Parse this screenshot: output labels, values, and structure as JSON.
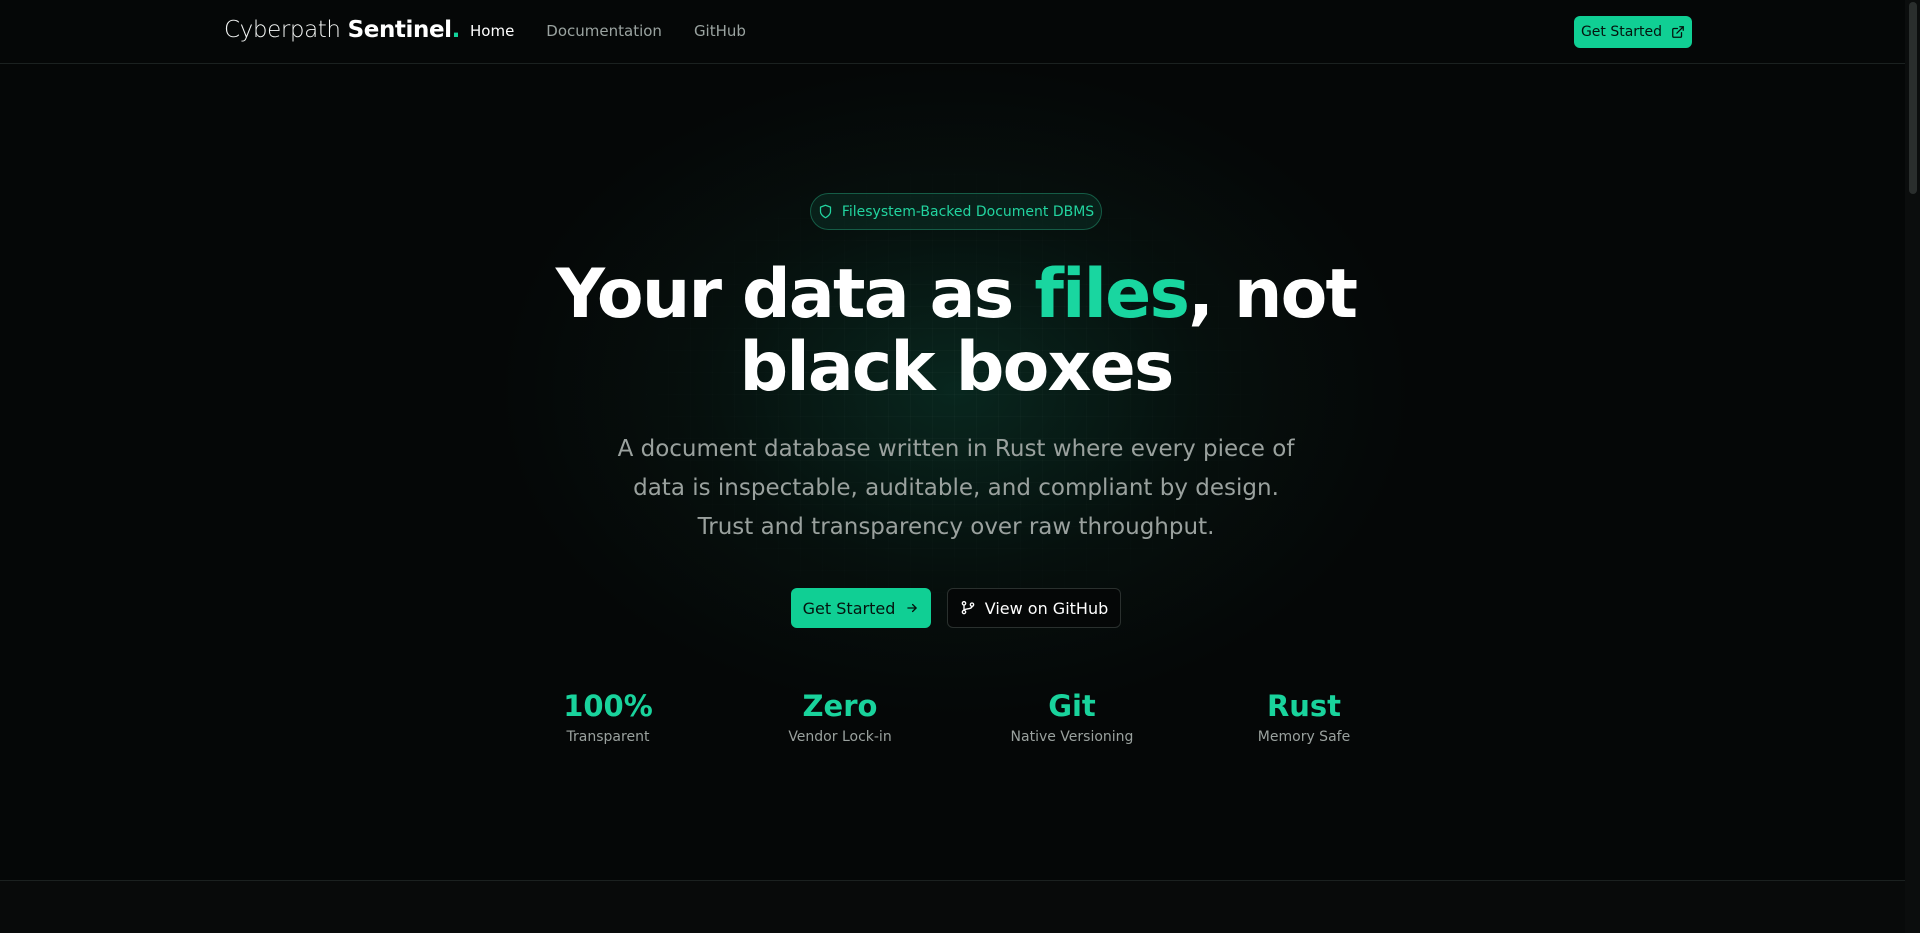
{
  "brand": {
    "name_light": "Cyberpath",
    "name_bold": "Sentinel",
    "dot": "."
  },
  "nav": {
    "items": [
      "Home",
      "Documentation",
      "GitHub"
    ],
    "active": "Home"
  },
  "header": {
    "cta_label": "Get Started",
    "cta_icon": "external-link-icon"
  },
  "hero": {
    "badge_icon": "shield-icon",
    "badge_label": "Filesystem-Backed Document DBMS",
    "headline_before": "Your data as ",
    "headline_highlight": "files",
    "headline_after": ", not black boxes",
    "subtitle": "A document database written in Rust where every piece of data is inspectable, auditable, and compliant by design. Trust and transparency over raw throughput.",
    "primary_cta": "Get Started",
    "primary_cta_icon": "arrow-right-icon",
    "secondary_cta": "View on GitHub",
    "secondary_cta_icon": "git-branch-icon"
  },
  "stats": [
    {
      "value": "100%",
      "label": "Transparent"
    },
    {
      "value": "Zero",
      "label": "Vendor Lock-in"
    },
    {
      "value": "Git",
      "label": "Native Versioning"
    },
    {
      "value": "Rust",
      "label": "Memory Safe"
    }
  ],
  "colors": {
    "accent": "#10cf94",
    "background": "#050707",
    "muted_text": "#9aa19e"
  }
}
